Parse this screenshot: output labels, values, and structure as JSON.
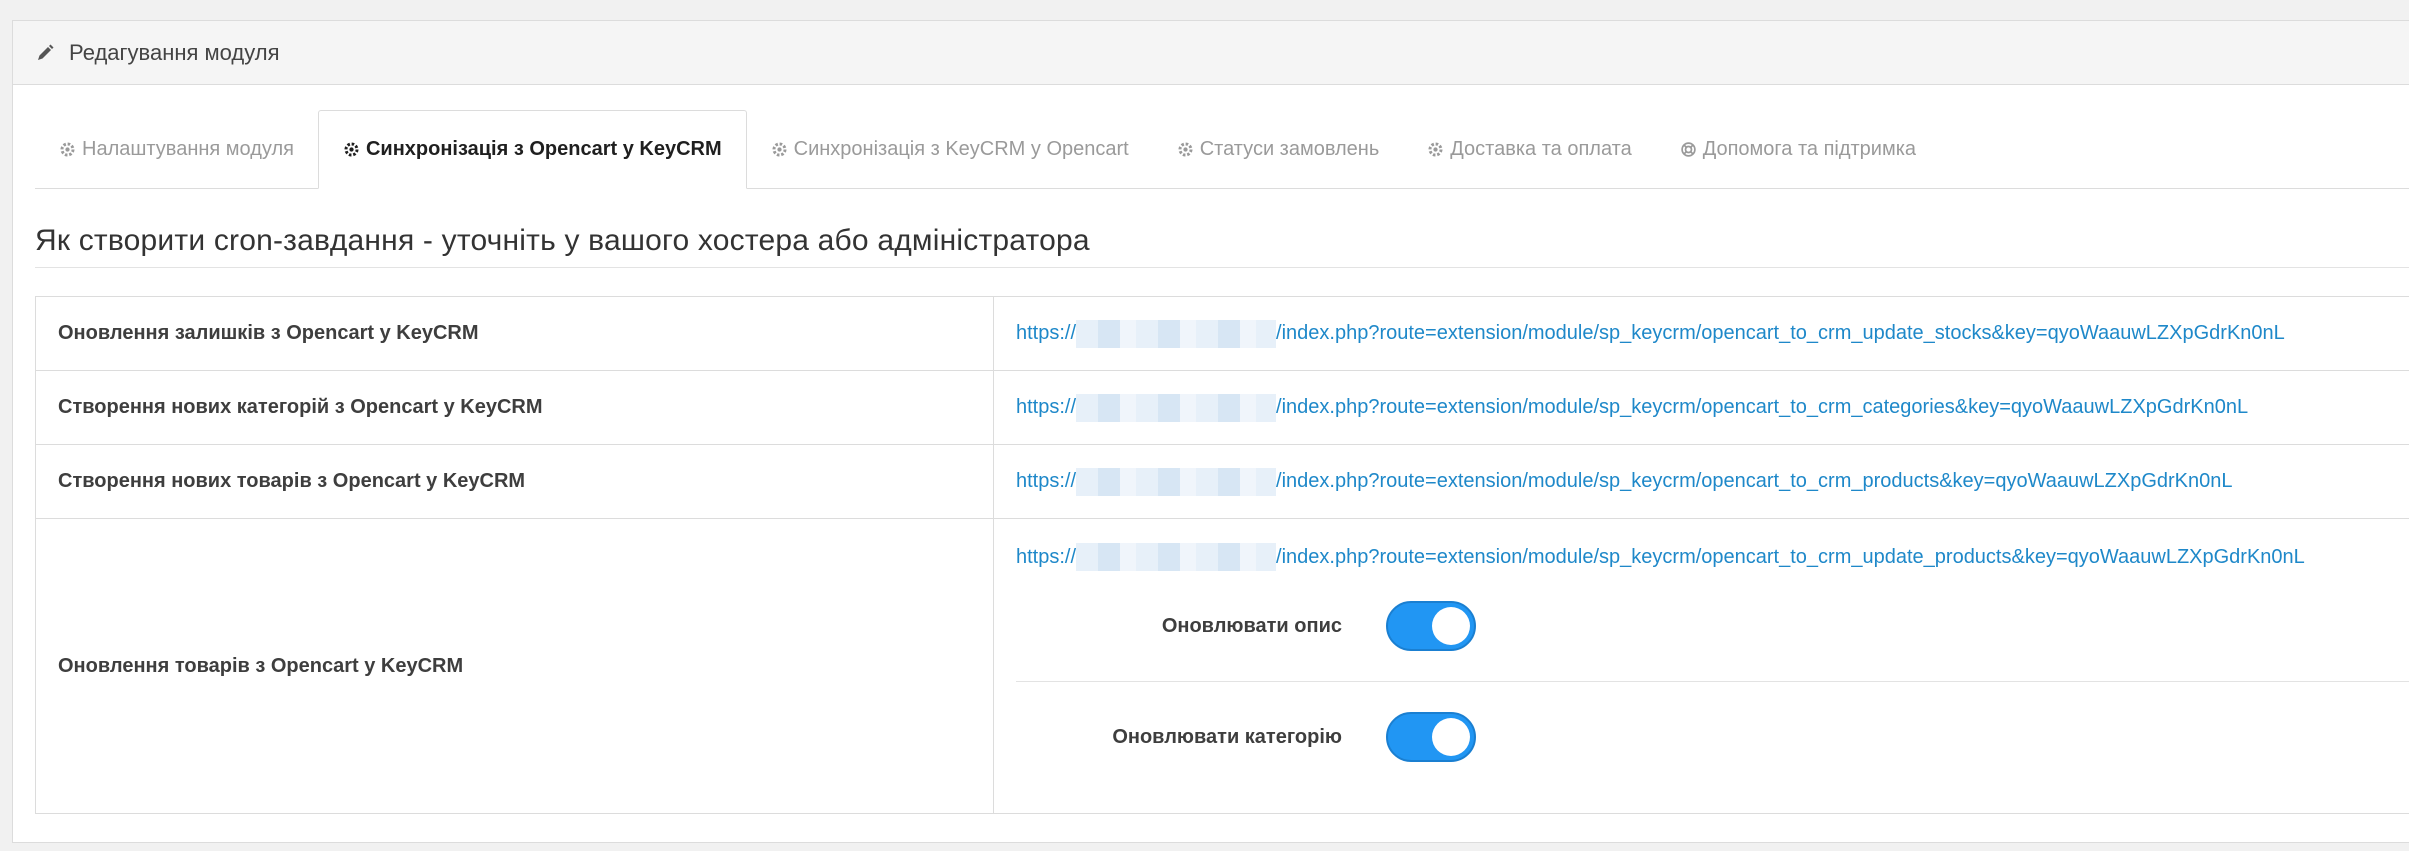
{
  "header": {
    "title": "Редагування модуля",
    "icon": "pencil-icon"
  },
  "tabs": [
    {
      "label": "Налаштування модуля",
      "icon": "gear-icon",
      "active": false
    },
    {
      "label": "Синхронізація з Opencart у KeyCRM",
      "icon": "gear-icon",
      "active": true
    },
    {
      "label": "Синхронізація з KeyCRM у Opencart",
      "icon": "gear-icon",
      "active": false
    },
    {
      "label": "Статуси замовлень",
      "icon": "gear-icon",
      "active": false
    },
    {
      "label": "Доставка та оплата",
      "icon": "gear-icon",
      "active": false
    },
    {
      "label": "Допомога та підтримка",
      "icon": "lifebuoy-icon",
      "active": false
    }
  ],
  "section_title": "Як створити cron-завдання - уточніть у вашого хостера або адміністратора",
  "rows": [
    {
      "label": "Оновлення залишків з Opencart у KeyCRM",
      "url_prefix": "https://",
      "url_suffix": "/index.php?route=extension/module/sp_keycrm/opencart_to_crm_update_stocks&key=qyoWaauwLZXpGdrKn0nL"
    },
    {
      "label": "Створення нових категорій з Opencart у KeyCRM",
      "url_prefix": "https://",
      "url_suffix": "/index.php?route=extension/module/sp_keycrm/opencart_to_crm_categories&key=qyoWaauwLZXpGdrKn0nL"
    },
    {
      "label": "Створення нових товарів з Opencart у KeyCRM",
      "url_prefix": "https://",
      "url_suffix": "/index.php?route=extension/module/sp_keycrm/opencart_to_crm_products&key=qyoWaauwLZXpGdrKn0nL"
    },
    {
      "label": "Оновлення товарів з Opencart у KeyCRM",
      "url_prefix": "https://",
      "url_suffix": "/index.php?route=extension/module/sp_keycrm/opencart_to_crm_update_products&key=qyoWaauwLZXpGdrKn0nL"
    }
  ],
  "options": [
    {
      "label": "Оновлювати опис",
      "enabled": true
    },
    {
      "label": "Оновлювати категорію",
      "enabled": true
    }
  ],
  "colors": {
    "link": "#1e88c9",
    "switch_on": "#2196f3"
  }
}
